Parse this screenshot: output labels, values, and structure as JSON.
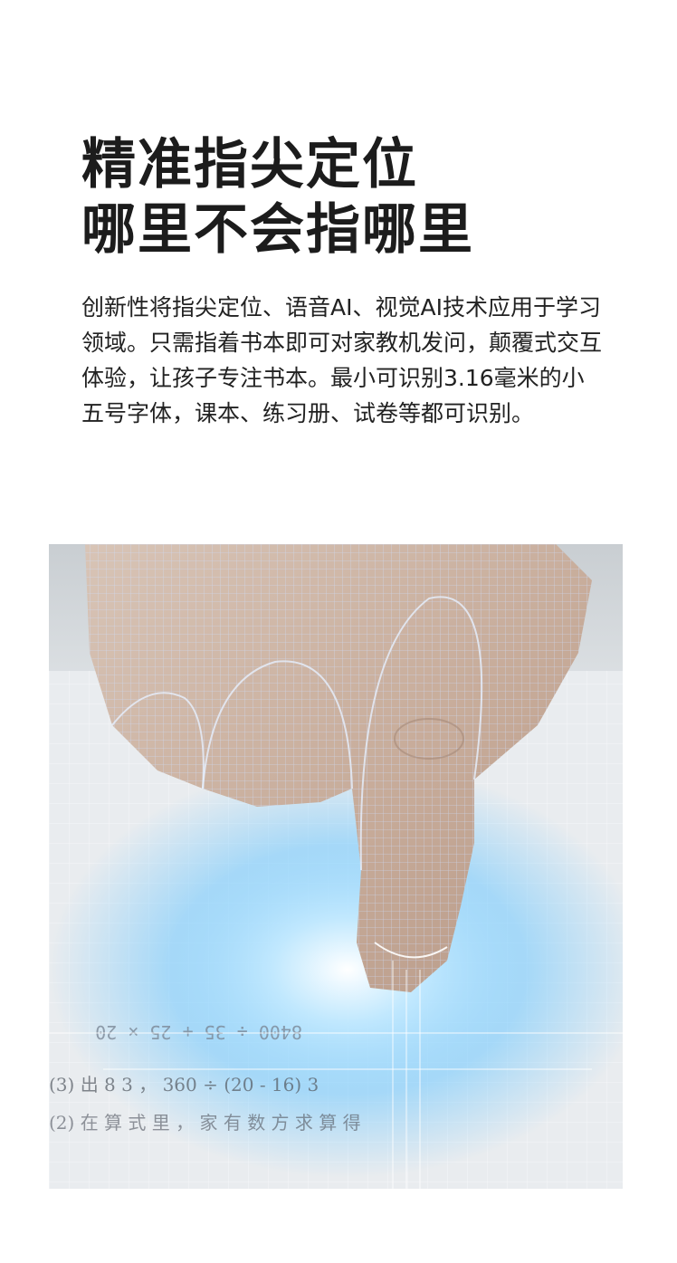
{
  "headline": {
    "line1": "精准指尖定位",
    "line2": "哪里不会指哪里"
  },
  "description": "创新性将指尖定位、语音AI、视觉AI技术应用于学习领域。只需指着书本即可对家教机发问，颠覆式交互体验，让孩子专注书本。最小可识别3.16毫米的小五号字体，课本、练习册、试卷等都可识别。",
  "hero_image": {
    "alt": "finger-pointing-at-textbook-with-wireframe-scan",
    "page_text": [
      "8400 ÷ 35 + 25 × 20",
      "(3) 出 8 3 ， 360 ÷ (20 - 16) 3",
      "(2) 在 算 式 里 ， 家 有 数 方 求 算 得"
    ],
    "colors": {
      "glow": "#6ec8ff",
      "mesh": "#bcd6ff",
      "skin": "#cdb5a6",
      "paper": "#e6e9ec"
    }
  }
}
